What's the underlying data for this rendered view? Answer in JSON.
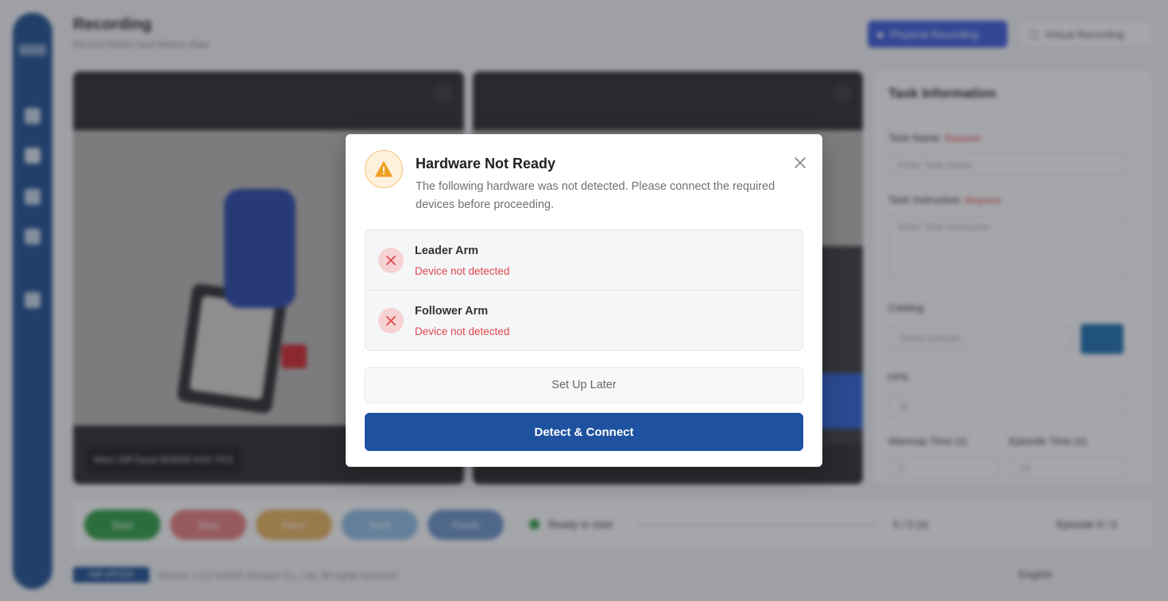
{
  "background": {
    "page_title": "Recording",
    "page_subtitle": "Record Robot Hard Motion Data",
    "mode_physical_label": "Physical Recording",
    "mode_virtual_label": "Virtual Recording",
    "camera_left_caption": "Mars Diff Dyad 909049 KA3 YK3",
    "task_panel": {
      "title": "Task Information",
      "task_name_label": "Task Name",
      "task_name_placeholder": "Enter Task Name",
      "task_instruction_label": "Task Instruction",
      "task_instruction_placeholder": "Enter Task Instruction",
      "required_label": "Required",
      "catalog_label": "Catalog",
      "catalog_placeholder": "Select Dataset",
      "fps_label": "FPS",
      "fps_value": "30",
      "warmup_label": "Warmup Time (s)",
      "warmup_value": "5",
      "episode_time_label": "Episode Time (s)",
      "episode_time_value": "20"
    },
    "controls": {
      "start": "Start",
      "stop": "Stop",
      "retry": "Retry",
      "next": "Next",
      "finish": "Finish"
    },
    "status_text": "Ready to start",
    "time_text": "0 / 0 (s)",
    "episode_text": "Episode 0 / 0",
    "footer_version_badge": "AIR ePOCh",
    "footer_copyright": "Version 1.0.0 ©2025 Airwave Co., Ltd. All rights reserved",
    "footer_language": "English"
  },
  "dialog": {
    "title": "Hardware Not Ready",
    "description": "The following hardware was not detected. Please connect the required devices before proceeding.",
    "devices": [
      {
        "name": "Leader Arm",
        "status": "Device not detected"
      },
      {
        "name": "Follower Arm",
        "status": "Device not detected"
      }
    ],
    "secondary_button": "Set Up Later",
    "primary_button": "Detect & Connect",
    "colors": {
      "warning": "#f0a020",
      "error": "#e0474c",
      "primary": "#1e52a0"
    }
  }
}
